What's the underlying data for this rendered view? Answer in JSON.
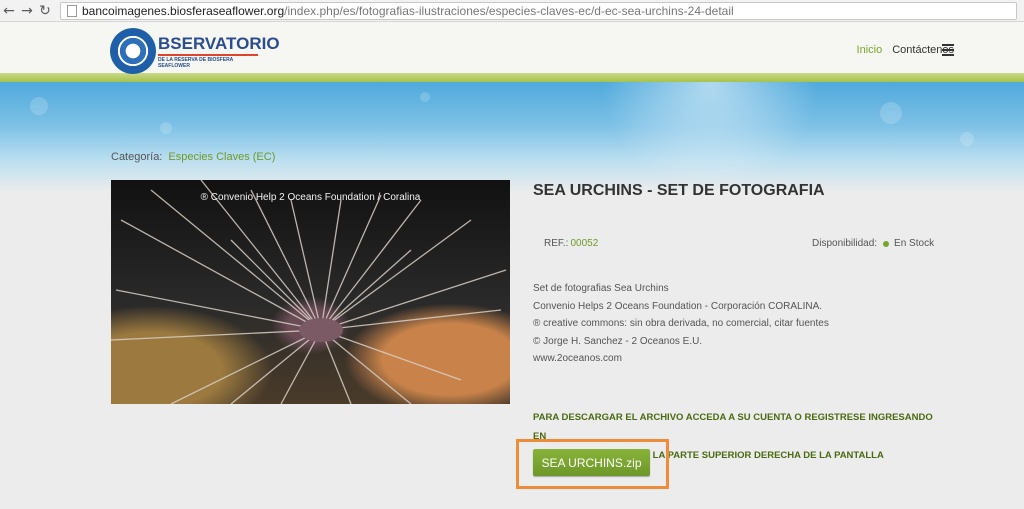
{
  "browser": {
    "url_domain": "bancoimagenes.biosferaseaflower.org",
    "url_path": "/index.php/es/fotografias-ilustraciones/especies-claves-ec/d-ec-sea-urchins-24-detail"
  },
  "header": {
    "logo_title": "BSERVATORIO",
    "logo_subtitle": "DE LA RESERVA DE BIOSFERA SEAFLOWER",
    "nav": [
      "Inicio",
      "Contáctenos"
    ],
    "accent_color": "#7aa52a"
  },
  "category": {
    "label": "Categoría:",
    "value": "Especies Claves (EC)"
  },
  "photo": {
    "watermark": "® Convenio Help 2 Oceans Foundation / Coralina"
  },
  "product": {
    "title": "SEA URCHINS - SET DE FOTOGRAFIA",
    "ref_label": "REF.:",
    "ref_value": "00052",
    "availability_label": "Disponibilidad:",
    "availability_value": "En Stock",
    "description": [
      "Set de fotografias Sea Urchins",
      "Convenio Helps 2 Oceans Foundation - Corporación CORALINA.",
      "® creative commons: sin obra derivada, no comercial, citar fuentes",
      "© Jorge H. Sanchez - 2 Oceanos E.U.",
      "www.2oceanos.com"
    ],
    "notice_line1": "PARA DESCARGAR EL ARCHIVO ACCEDA A SU CUENTA O REGISTRESE INGRESANDO EN",
    "notice_line2": "EL BOTÓN \"ACCESO\" EN LA PARTE SUPERIOR DERECHA DE LA PANTALLA",
    "download_label": "SEA URCHINS.zip",
    "highlight_color": "#f08b3a"
  }
}
